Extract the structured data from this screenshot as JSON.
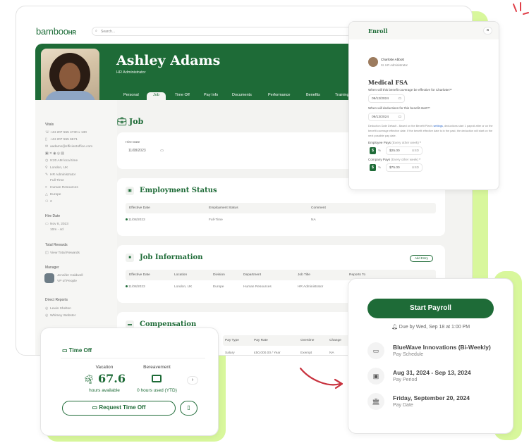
{
  "brand": {
    "logo": "bamboo",
    "logo_suffix": "HR",
    "accent": "#1e6b37",
    "highlight": "#d8f79c"
  },
  "search": {
    "placeholder": "Search..."
  },
  "profile": {
    "name": "Ashley Adams",
    "title": "HR Administrator"
  },
  "tabs": [
    "Personal",
    "Job",
    "Time Off",
    "Pay Info",
    "Documents",
    "Performance",
    "Benefits",
    "Training"
  ],
  "active_tab": "Job",
  "sidebar": {
    "vitals_label": "Vitals",
    "vitals": [
      "+44 207 555 4730 x 130",
      "+44 207 555 6671",
      "aadams@efficientoffice.com",
      "9:20 AM local time",
      "London, UK",
      "HR Administrator",
      "Full-Time",
      "Human Resources",
      "Europe",
      "2"
    ],
    "hire_date_label": "Hire Date",
    "hire_date": "Nov 8, 2023",
    "tenure": "10m - 4d",
    "rewards_label": "Total Rewards",
    "rewards_link": "View Total Rewards",
    "manager_label": "Manager",
    "manager_name": "Jennifer Caldwell",
    "manager_title": "VP of People",
    "reports_label": "Direct Reports",
    "reports": [
      "Lewis Shelton",
      "Whitney Webster"
    ]
  },
  "job": {
    "heading": "Job",
    "hire_date_label": "Hire Date",
    "hire_date": "11/08/2023",
    "employment_status": {
      "title": "Employment Status",
      "columns": [
        "Effective Date",
        "Employment Status",
        "Comment"
      ],
      "row": [
        "11/08/2023",
        "Full-Time",
        "NA"
      ]
    },
    "job_information": {
      "title": "Job Information",
      "add_entry": "Add Entry",
      "columns": [
        "Effective Date",
        "Location",
        "Division",
        "Department",
        "Job Title",
        "Reports To"
      ],
      "row": [
        "11/08/2023",
        "London, UK",
        "Europe",
        "Human Resources",
        "HR Administrator",
        ""
      ]
    },
    "compensation": {
      "title": "Compensation",
      "columns": [
        "Pay Type",
        "Pay Rate",
        "Overtime",
        "Change"
      ],
      "row": [
        "Salary",
        "£50,000.00 / Year",
        "Exempt",
        "NA"
      ]
    }
  },
  "enroll": {
    "title": "Enroll",
    "close": "×",
    "person": "Charlotte Abbott",
    "person_title": "Sr. HR Administrator",
    "plan": "Medical FSA",
    "q1": "When will this benefit coverage be effective for Charlotte?*",
    "q1_value": "09/12/2024",
    "q2": "When will deductions for this benefit start?*",
    "q2_value": "09/13/2024",
    "note_pre": "Deduction Date Default - Based on the Benefit Plan's ",
    "note_link": "settings",
    "note_post": ", deductions start 1 payroll after or on the benefit coverage effective date. If the benefit effective date is in the past, the deduction will start on the next possible pay date.",
    "employee_label": "Employee Pays",
    "employee_freq": "(Every other week)",
    "employee_value": "$25.00",
    "company_label": "Company Pays",
    "company_freq": "(Every other week)",
    "company_value": "$75.00",
    "currency": "USD",
    "dollar": "$",
    "percent": "%",
    "required": "*"
  },
  "time_off": {
    "title": "Time Off",
    "vacation_label": "Vacation",
    "vacation_value": "67.6",
    "vacation_sub": "hours available",
    "bereavement_label": "Bereavement",
    "bereavement_sub": "0 hours used (YTD)",
    "request_button": "Request Time Off"
  },
  "payroll": {
    "start_button": "Start Payroll",
    "due": "Due by Wed, Sep 18 at 1:00 PM",
    "items": [
      {
        "title": "BlueWave Innovations (Bi-Weekly)",
        "sub": "Pay Schedule",
        "icon": "calendar-icon"
      },
      {
        "title": "Aug 31, 2024 - Sep 13, 2024",
        "sub": "Pay Period",
        "icon": "calendar-range-icon"
      },
      {
        "title": "Friday, September 20, 2024",
        "sub": "Pay Date",
        "icon": "bank-icon"
      }
    ]
  }
}
